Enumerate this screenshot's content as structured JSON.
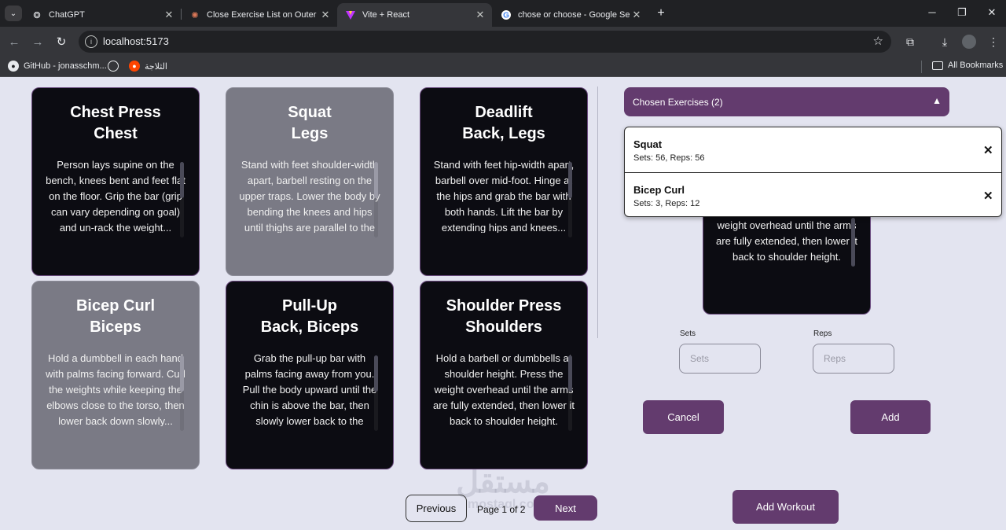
{
  "browser": {
    "tabs": [
      {
        "title": "ChatGPT",
        "icon": "chatgpt-icon"
      },
      {
        "title": "Close Exercise List on Outer Cli",
        "icon": "claude-icon"
      },
      {
        "title": "Vite + React",
        "icon": "vite-icon",
        "active": true
      },
      {
        "title": "chose or choose - Google Searc",
        "icon": "google-icon"
      }
    ],
    "url": "localhost:5173",
    "bookmarks": [
      {
        "label": "GitHub - jonasschm...",
        "icon": "github-icon"
      },
      {
        "label": "",
        "icon": "globe-icon"
      },
      {
        "label": "الثلاجة",
        "icon": "reddit-icon"
      }
    ],
    "all_bookmarks": "All Bookmarks"
  },
  "exercises": [
    {
      "name": "Chest Press",
      "muscle": "Chest",
      "description": "Person lays supine on the bench, knees bent and feet flat on the floor. Grip the bar (grip can vary depending on goal) and un-rack the weight...",
      "selected": false
    },
    {
      "name": "Squat",
      "muscle": "Legs",
      "description": "Stand with feet shoulder-width apart, barbell resting on the upper traps. Lower the body by bending the knees and hips until thighs are parallel to the floor...",
      "selected": true
    },
    {
      "name": "Deadlift",
      "muscle": "Back, Legs",
      "description": "Stand with feet hip-width apart, barbell over mid-foot. Hinge at the hips and grab the bar with both hands. Lift the bar by extending hips and knees...",
      "selected": false
    },
    {
      "name": "Bicep Curl",
      "muscle": "Biceps",
      "description": "Hold a dumbbell in each hand with palms facing forward. Curl the weights while keeping the elbows close to the torso, then lower back down slowly...",
      "selected": true
    },
    {
      "name": "Pull-Up",
      "muscle": "Back, Biceps",
      "description": "Grab the pull-up bar with palms facing away from you. Pull the body upward until the chin is above the bar, then slowly lower back to the starting position...",
      "selected": false
    },
    {
      "name": "Shoulder Press",
      "muscle": "Shoulders",
      "description": "Hold a barbell or dumbbells at shoulder height. Press the weight overhead until the arms are fully extended, then lower it back to shoulder height.",
      "selected": false
    }
  ],
  "detail_card": {
    "description": "weight overhead until the arms are fully extended, then lower it back to shoulder height."
  },
  "chosen": {
    "header": "Chosen Exercises (2)",
    "items": [
      {
        "name": "Squat",
        "detail": "Sets: 56, Reps: 56"
      },
      {
        "name": "Bicep Curl",
        "detail": "Sets: 3, Reps: 12"
      }
    ]
  },
  "form": {
    "sets_label": "Sets",
    "sets_placeholder": "Sets",
    "reps_label": "Reps",
    "reps_placeholder": "Reps",
    "cancel": "Cancel",
    "add": "Add"
  },
  "pagination": {
    "previous": "Previous",
    "info": "Page 1 of 2",
    "next": "Next"
  },
  "add_workout": "Add Workout",
  "watermark": {
    "text": "مستقل",
    "sub": "mostaql.com"
  }
}
